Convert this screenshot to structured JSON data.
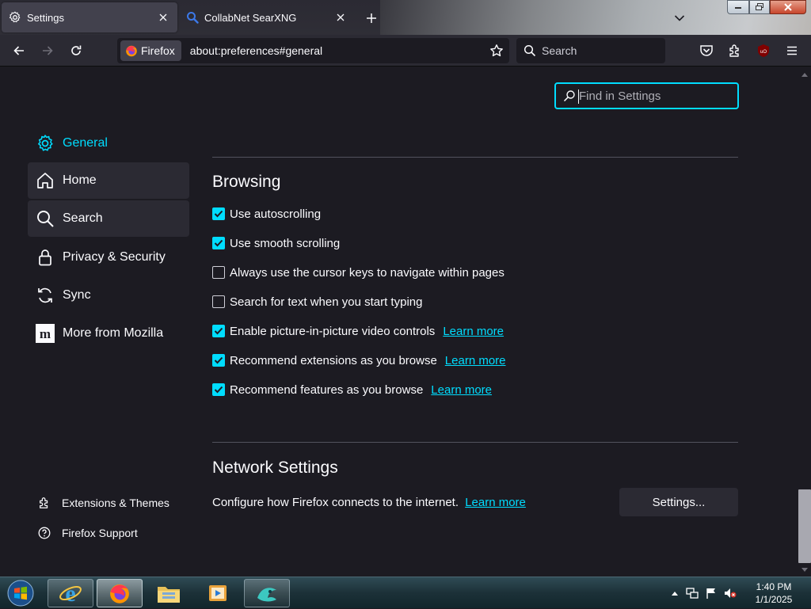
{
  "window": {
    "tabs": [
      {
        "label": "Settings",
        "icon": "gear-icon",
        "active": true
      },
      {
        "label": "CollabNet SearXNG",
        "icon": "search-icon",
        "active": false
      }
    ]
  },
  "navbar": {
    "identity_label": "Firefox",
    "url": "about:preferences#general",
    "search_placeholder": "Search"
  },
  "settings": {
    "find_placeholder": "Find in Settings",
    "categories": [
      {
        "label": "General",
        "icon": "gear-icon",
        "selected": true
      },
      {
        "label": "Home",
        "icon": "home-icon",
        "selected": false
      },
      {
        "label": "Search",
        "icon": "search-icon",
        "selected": false
      },
      {
        "label": "Privacy & Security",
        "icon": "lock-icon",
        "selected": false
      },
      {
        "label": "Sync",
        "icon": "sync-icon",
        "selected": false
      },
      {
        "label": "More from Mozilla",
        "icon": "mozilla-icon",
        "selected": false
      }
    ],
    "footer_links": [
      {
        "label": "Extensions & Themes",
        "icon": "puzzle-icon"
      },
      {
        "label": "Firefox Support",
        "icon": "help-icon"
      }
    ],
    "browsing": {
      "heading": "Browsing",
      "options": [
        {
          "label": "Use autoscrolling",
          "checked": true,
          "link": ""
        },
        {
          "label": "Use smooth scrolling",
          "checked": true,
          "link": ""
        },
        {
          "label": "Always use the cursor keys to navigate within pages",
          "checked": false,
          "link": ""
        },
        {
          "label": "Search for text when you start typing",
          "checked": false,
          "link": ""
        },
        {
          "label": "Enable picture-in-picture video controls",
          "checked": true,
          "link": "Learn more"
        },
        {
          "label": "Recommend extensions as you browse",
          "checked": true,
          "link": "Learn more"
        },
        {
          "label": "Recommend features as you browse",
          "checked": true,
          "link": "Learn more"
        }
      ]
    },
    "network": {
      "heading": "Network Settings",
      "description": "Configure how Firefox connects to the internet.",
      "link": "Learn more",
      "button": "Settings..."
    }
  },
  "taskbar": {
    "apps": [
      "internet-explorer-icon",
      "firefox-icon",
      "file-explorer-icon",
      "media-player-icon",
      "app-icon"
    ],
    "clock_time": "1:40 PM",
    "clock_date": "1/1/2025"
  },
  "colors": {
    "accent": "#00ddff",
    "background": "#1c1b22",
    "toolbar": "#2b2a33"
  }
}
